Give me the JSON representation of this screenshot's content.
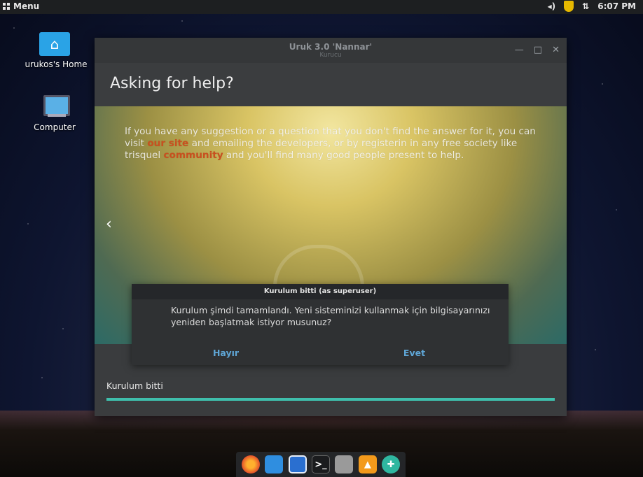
{
  "topbar": {
    "menu_label": "Menu",
    "volume_icon": "speaker-icon",
    "shield_icon": "shield-icon",
    "network_icon": "network-arrows-icon",
    "clock": "6:07 PM"
  },
  "desktop": {
    "home_label": "urukos's Home",
    "computer_label": "Computer"
  },
  "window": {
    "title": "Uruk 3.0 'Nannar'",
    "subtitle": "Kurucu",
    "page_title": "Asking for help?",
    "slide": {
      "text_before_site": "If you have any suggestion or a question that you don't find the answer for it, you can visit ",
      "site_link": "our site",
      "text_middle": " and emailing the developers, or by registerin in any free society like trisquel ",
      "community_link": "community",
      "text_after": " and you'll find many good people present to help."
    },
    "status_label": "Kurulum bitti",
    "progress_fraction": 1.0,
    "accent": "#3fbfac"
  },
  "dialog": {
    "title": "Kurulum bitti (as superuser)",
    "message": "Kurulum şimdi tamamlandı. Yeni sisteminizi kullanmak için bilgisayarınızı yeniden başlatmak istiyor musunuz?",
    "no_label": "Hayır",
    "yes_label": "Evet"
  },
  "dock": {
    "items": [
      "firefox-icon",
      "folder-icon",
      "mail-icon",
      "terminal-icon",
      "document-icon",
      "vlc-icon",
      "globe-icon"
    ]
  }
}
